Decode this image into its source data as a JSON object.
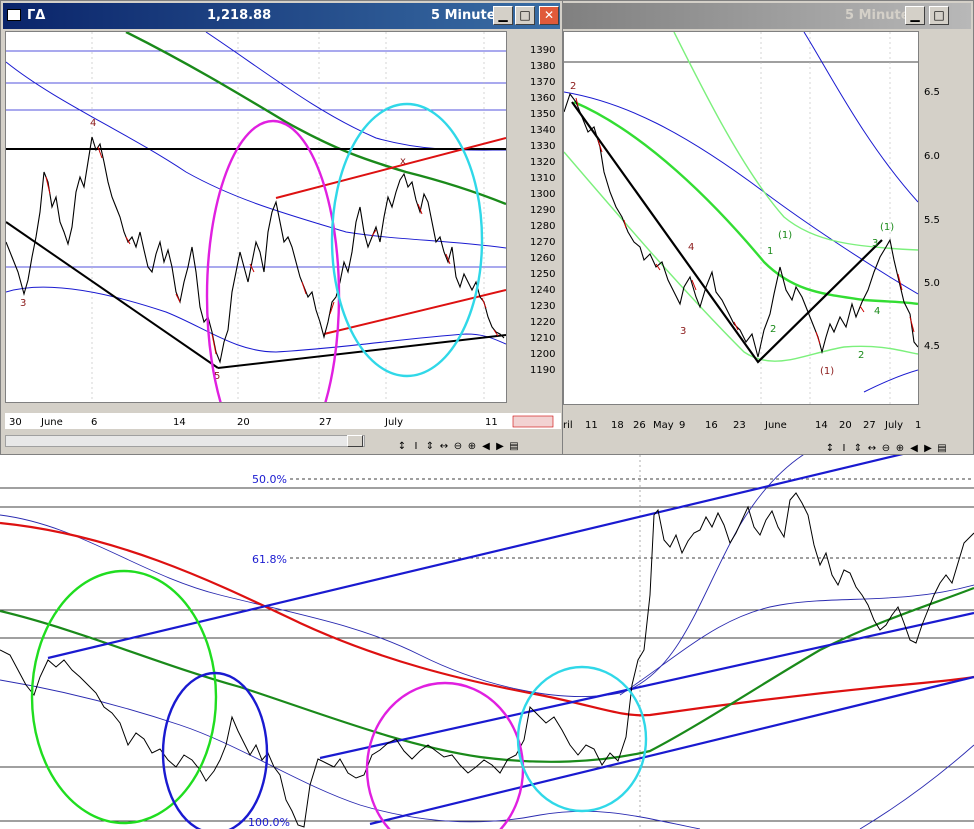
{
  "window_left": {
    "icon": "chart-window-icon",
    "symbol": "ΓΔ",
    "price": "1,218.88",
    "interval": "5 Minute",
    "y_ticks": [
      "1390",
      "1380",
      "1370",
      "1360",
      "1350",
      "1340",
      "1330",
      "1320",
      "1310",
      "1300",
      "1290",
      "1280",
      "1270",
      "1260",
      "1250",
      "1240",
      "1230",
      "1220",
      "1210",
      "1200",
      "1190"
    ],
    "x_labels": [
      "30",
      "June",
      "6",
      "14",
      "20",
      "27",
      "July",
      "11"
    ],
    "wave_labels": [
      "4",
      "3",
      "5",
      "x"
    ]
  },
  "window_right": {
    "interval": "5 Minute",
    "y_ticks": [
      "6.5",
      "6.0",
      "5.5",
      "5.0",
      "4.5"
    ],
    "x_labels": [
      "ril",
      "11",
      "18",
      "26",
      "May",
      "9",
      "16",
      "23",
      "June",
      "14",
      "20",
      "27",
      "July",
      "1"
    ],
    "wave_labels": [
      "2",
      "4",
      "3",
      "1",
      "2",
      "(1)",
      "(1)",
      "2",
      "(1)",
      "3",
      "4"
    ]
  },
  "bottom_chart": {
    "fib_labels": [
      "50.0%",
      "61.8%",
      "100.0%"
    ]
  },
  "colors": {
    "title_active": "#0a246a",
    "title_inactive": "#808080",
    "price": "#000000",
    "down_bar": "#cc0000",
    "ma_green": "#1a8a1a",
    "ma_red": "#dd1111",
    "trend_blue": "#1a1ad0",
    "thin_blue": "#2a2ab0",
    "circle_magenta": "#e020e0",
    "circle_cyan": "#30d8e8",
    "circle_green": "#20dd20",
    "circle_blue": "#1a1ad0",
    "light_green": "#7cf07c",
    "bright_green": "#33dd33"
  },
  "toolbar_icons": [
    "zoom-reset-icon",
    "cursor-icon",
    "vertical-scale-icon",
    "horizontal-scale-icon",
    "zoom-out-icon",
    "zoom-in-icon",
    "scroll-left-icon",
    "scroll-right-icon",
    "settings-icon"
  ]
}
